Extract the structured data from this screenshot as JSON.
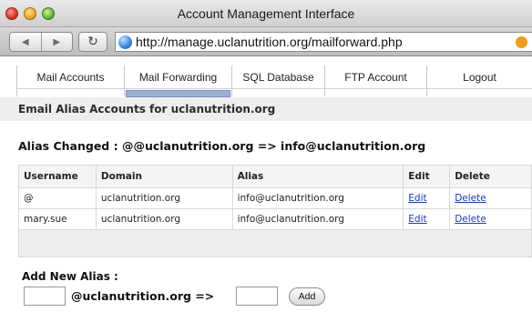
{
  "window": {
    "title": "Account Management Interface",
    "url": "http://manage.uclanutrition.org/mailforward.php"
  },
  "toolbar": {
    "back_icon": "◀",
    "forward_icon": "▶",
    "reload_icon": "↻"
  },
  "tabs": [
    {
      "label": "Mail Accounts",
      "active": false
    },
    {
      "label": "Mail Forwarding",
      "active": true
    },
    {
      "label": "SQL Database",
      "active": false
    },
    {
      "label": "FTP Account",
      "active": false
    },
    {
      "label": "Logout",
      "active": false
    }
  ],
  "page": {
    "heading": "Email Alias Accounts for uclanutrition.org",
    "status_message": "Alias Changed : @@uclanutrition.org => info@uclanutrition.org"
  },
  "table": {
    "headers": [
      "Username",
      "Domain",
      "Alias",
      "Edit",
      "Delete"
    ],
    "rows": [
      [
        "@",
        "uclanutrition.org",
        "info@uclanutrition.org",
        "Edit",
        "Delete"
      ],
      [
        "mary.sue",
        "uclanutrition.org",
        "info@uclanutrition.org",
        "Edit",
        "Delete"
      ]
    ]
  },
  "add_alias": {
    "title": "Add New Alias :",
    "username_value": "",
    "domain_suffix": "@uclanutrition.org =>",
    "alias_value": "",
    "button_label": "Add"
  },
  "colors": {
    "link": "#1a35d6",
    "active_tab": "#9ab0d4",
    "heading_bg": "#eeeeee"
  }
}
